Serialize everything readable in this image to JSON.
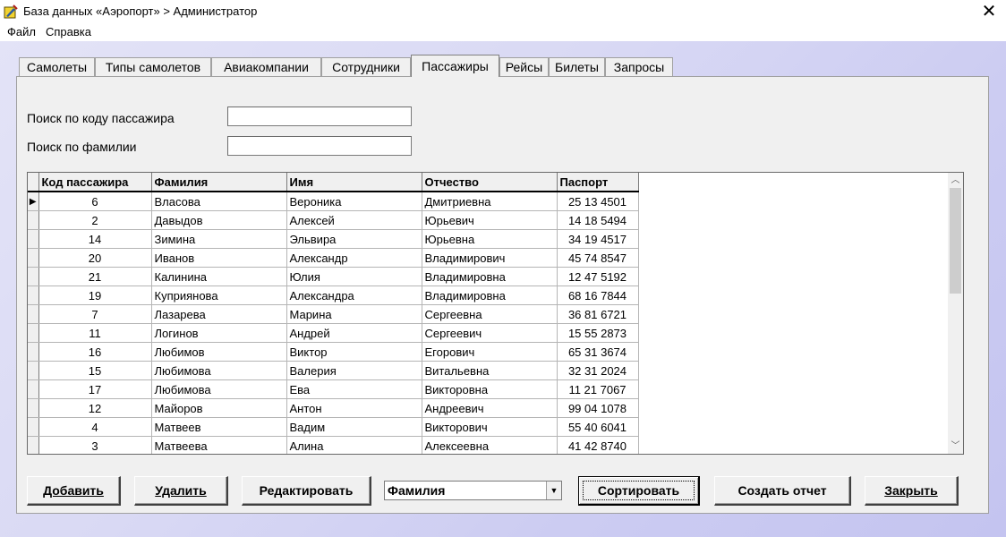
{
  "window": {
    "title": "База данных «Аэропорт» > Администратор",
    "close_glyph": "✕"
  },
  "menu": [
    "Файл",
    "Справка"
  ],
  "tabs": [
    {
      "label": "Самолеты",
      "active": false
    },
    {
      "label": "Типы самолетов",
      "active": false
    },
    {
      "label": "Авиакомпании",
      "active": false
    },
    {
      "label": "Сотрудники",
      "active": false
    },
    {
      "label": "Пассажиры",
      "active": true
    },
    {
      "label": "Рейсы",
      "active": false
    },
    {
      "label": "Билеты",
      "active": false
    },
    {
      "label": "Запросы",
      "active": false
    }
  ],
  "search": {
    "by_code_label": "Поиск по коду пассажира",
    "by_code_value": "",
    "by_surname_label": "Поиск по фамилии",
    "by_surname_value": ""
  },
  "table": {
    "columns": [
      "Код пассажира",
      "Фамилия",
      "Имя",
      "Отчество",
      "Паспорт"
    ],
    "rows": [
      [
        "6",
        "Власова",
        "Вероника",
        "Дмитриевна",
        "25 13 4501"
      ],
      [
        "2",
        "Давыдов",
        "Алексей",
        "Юрьевич",
        "14 18 5494"
      ],
      [
        "14",
        "Зимина",
        "Эльвира",
        "Юрьевна",
        "34 19 4517"
      ],
      [
        "20",
        "Иванов",
        "Александр",
        "Владимирович",
        "45 74 8547"
      ],
      [
        "21",
        "Калинина",
        "Юлия",
        "Владимировна",
        "12 47 5192"
      ],
      [
        "19",
        "Куприянова",
        "Александра",
        "Владимировна",
        "68 16 7844"
      ],
      [
        "7",
        "Лазарева",
        "Марина",
        "Сергеевна",
        "36 81 6721"
      ],
      [
        "11",
        "Логинов",
        "Андрей",
        "Сергеевич",
        "15 55 2873"
      ],
      [
        "16",
        "Любимов",
        "Виктор",
        "Егорович",
        "65 31 3674"
      ],
      [
        "15",
        "Любимова",
        "Валерия",
        "Витальевна",
        "32 31 2024"
      ],
      [
        "17",
        "Любимова",
        "Ева",
        "Викторовна",
        "11 21 7067"
      ],
      [
        "12",
        "Майоров",
        "Антон",
        "Андреевич",
        "99 04 1078"
      ],
      [
        "4",
        "Матвеев",
        "Вадим",
        "Викторович",
        "55 40 6041"
      ],
      [
        "3",
        "Матвеева",
        "Алина",
        "Алексеевна",
        "41 42 8740"
      ]
    ],
    "current_row_marker": "▶"
  },
  "buttons": {
    "add": "Добавить",
    "delete": "Удалить",
    "edit": "Редактировать",
    "sort": "Сортировать",
    "report": "Создать отчет",
    "close": "Закрыть"
  },
  "sort_combo": {
    "selected": "Фамилия"
  }
}
